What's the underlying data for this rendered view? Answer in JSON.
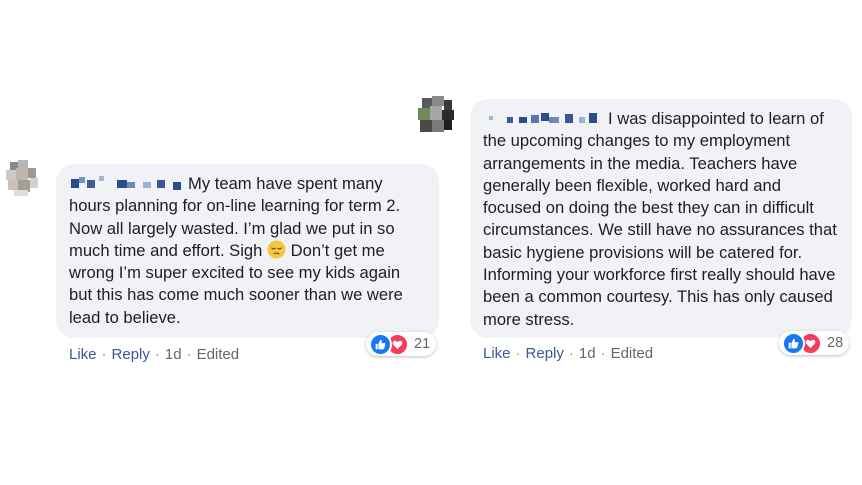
{
  "comments": [
    {
      "text": "My team have spent many hours planning for on-line learning for term 2. Now all largely wasted. I’m glad we put in so much time and effort. Sigh",
      "text_after_emoji": "Don’t get me wrong I’m super excited to see my kids again but this has come much sooner than we were lead to believe.",
      "emoji_icon": "pensive-face-icon",
      "actions": {
        "like": "Like",
        "reply": "Reply",
        "time": "1d",
        "edited": "Edited",
        "separator": "·"
      },
      "reaction_count": "21"
    },
    {
      "text": "I was disappointed to learn of the upcoming changes to my employment arrangements in the media. Teachers have generally been flexible, worked hard and focused on doing the best they can in difficult circumstances. We still have no assurances that basic hygiene provisions will be catered for. Informing your workforce first really should have been a common courtesy. This has only caused more stress.",
      "actions": {
        "like": "Like",
        "reply": "Reply",
        "time": "1d",
        "edited": "Edited",
        "separator": "·"
      },
      "reaction_count": "28"
    }
  ],
  "reaction_icons": [
    "like-reaction-icon",
    "love-reaction-icon"
  ],
  "colors": {
    "bubble": "#f0f2f5",
    "link": "#385898",
    "meta": "#65676b",
    "like": "#1877f2",
    "love": "#f33e58"
  }
}
